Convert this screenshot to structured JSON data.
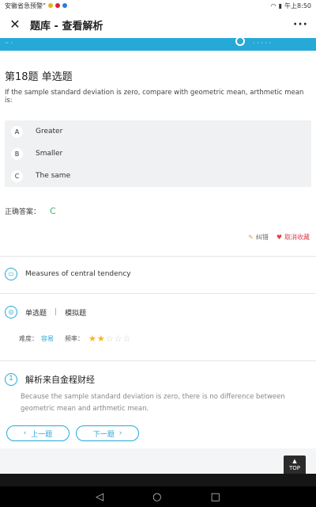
{
  "status_bar": {
    "left_text": "安徽省急预警“",
    "right_text": "午上8:50"
  },
  "title_bar": {
    "title": "题库 - 查看解析",
    "close_icon": "close-icon",
    "more_icon": "more-icon"
  },
  "question": {
    "title": "第18题 单选题",
    "text": "If the sample standard deviation is zero, compare with geometric mean, arthmetic mean is:",
    "options": [
      {
        "letter": "A",
        "text": "Greater"
      },
      {
        "letter": "B",
        "text": "Smaller"
      },
      {
        "letter": "C",
        "text": "The same"
      }
    ]
  },
  "answer": {
    "label": "正确答案：",
    "value": "C"
  },
  "actions": {
    "correct_label": "纠错",
    "favorite_label": "取消收藏"
  },
  "knowledge_point": {
    "text": "Measures of central tendency"
  },
  "question_meta": {
    "type": "单选题",
    "source": "模拟题",
    "difficulty_label": "难度：",
    "difficulty_value": "容易",
    "frequency_label": "频率：",
    "stars_filled": 2,
    "stars_total": 5
  },
  "analysis": {
    "number": "1",
    "title": "解析来自金程财经",
    "body": "Because the sample standard deviation is zero, there is no difference between geometric mean and arthmetic mean."
  },
  "navigation": {
    "prev_label": "上一题",
    "next_label": "下一题"
  },
  "top_button": {
    "label": "TOP"
  },
  "colors": {
    "accent": "#27a9d8",
    "answer": "#3cb371",
    "favorite": "#e0404f",
    "star": "#f3b61f"
  }
}
